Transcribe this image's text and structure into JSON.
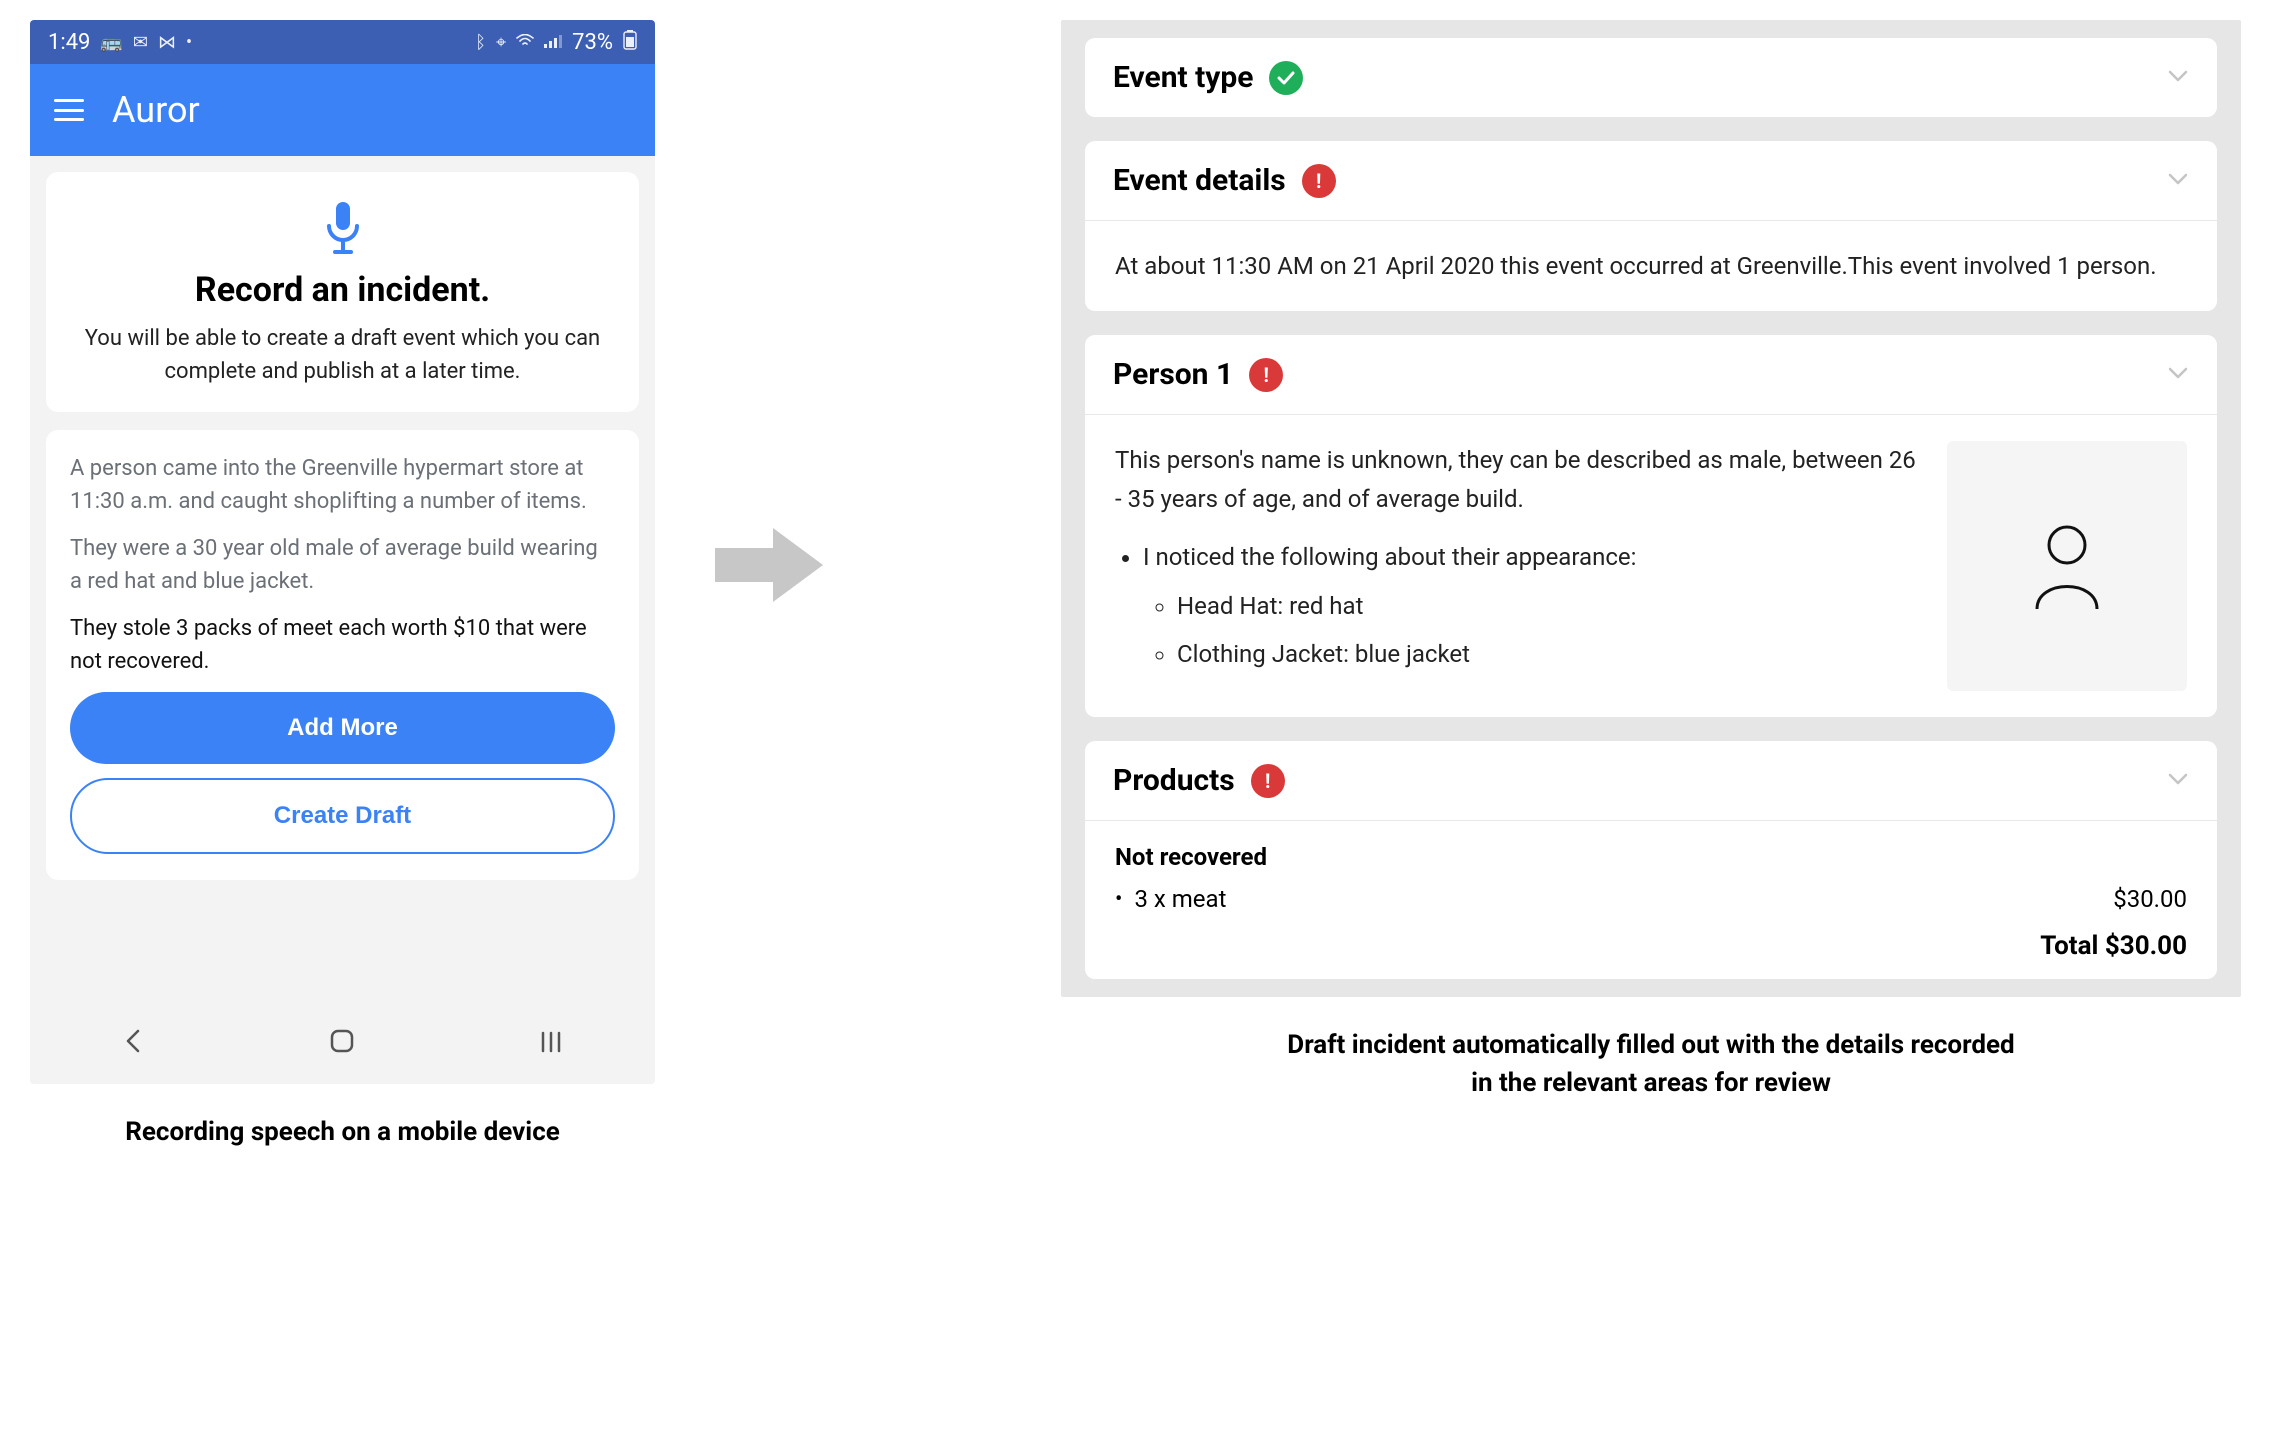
{
  "phone": {
    "statusbar": {
      "time": "1:49",
      "battery": "73%"
    },
    "appbar": {
      "title": "Auror"
    },
    "record": {
      "title": "Record an incident.",
      "subtitle": "You will be able to create a draft event which you can complete and publish at a later time."
    },
    "transcript": {
      "p1": "A person came into the Greenville hypermart store at 11:30 a.m. and caught shoplifting a number of items.",
      "p2": "They were a 30 year old male of average build wearing a red hat and blue jacket.",
      "p3": "They stole 3 packs of meet each worth $10 that were not recovered."
    },
    "buttons": {
      "add_more": "Add More",
      "create_draft": "Create Draft"
    },
    "caption": "Recording speech on a mobile device"
  },
  "review": {
    "event_type": {
      "title": "Event type"
    },
    "event_details": {
      "title": "Event details",
      "body": "At about 11:30 AM on 21 April 2020 this event occurred at Greenville.This event involved 1 person."
    },
    "person": {
      "title": "Person 1",
      "intro": "This person's name is unknown, they can be described as male, between 26 - 35 years of age, and of average build.",
      "appearance_label": "I noticed the following about their appearance:",
      "items": {
        "hat": "Head Hat: red hat",
        "jacket": "Clothing Jacket: blue jacket"
      }
    },
    "products": {
      "title": "Products",
      "subheading": "Not recovered",
      "line_label": "3 x meat",
      "line_price": "$30.00",
      "total": "Total $30.00"
    },
    "caption_l1": "Draft incident automatically filled out with the details recorded",
    "caption_l2": "in the relevant areas for review"
  }
}
